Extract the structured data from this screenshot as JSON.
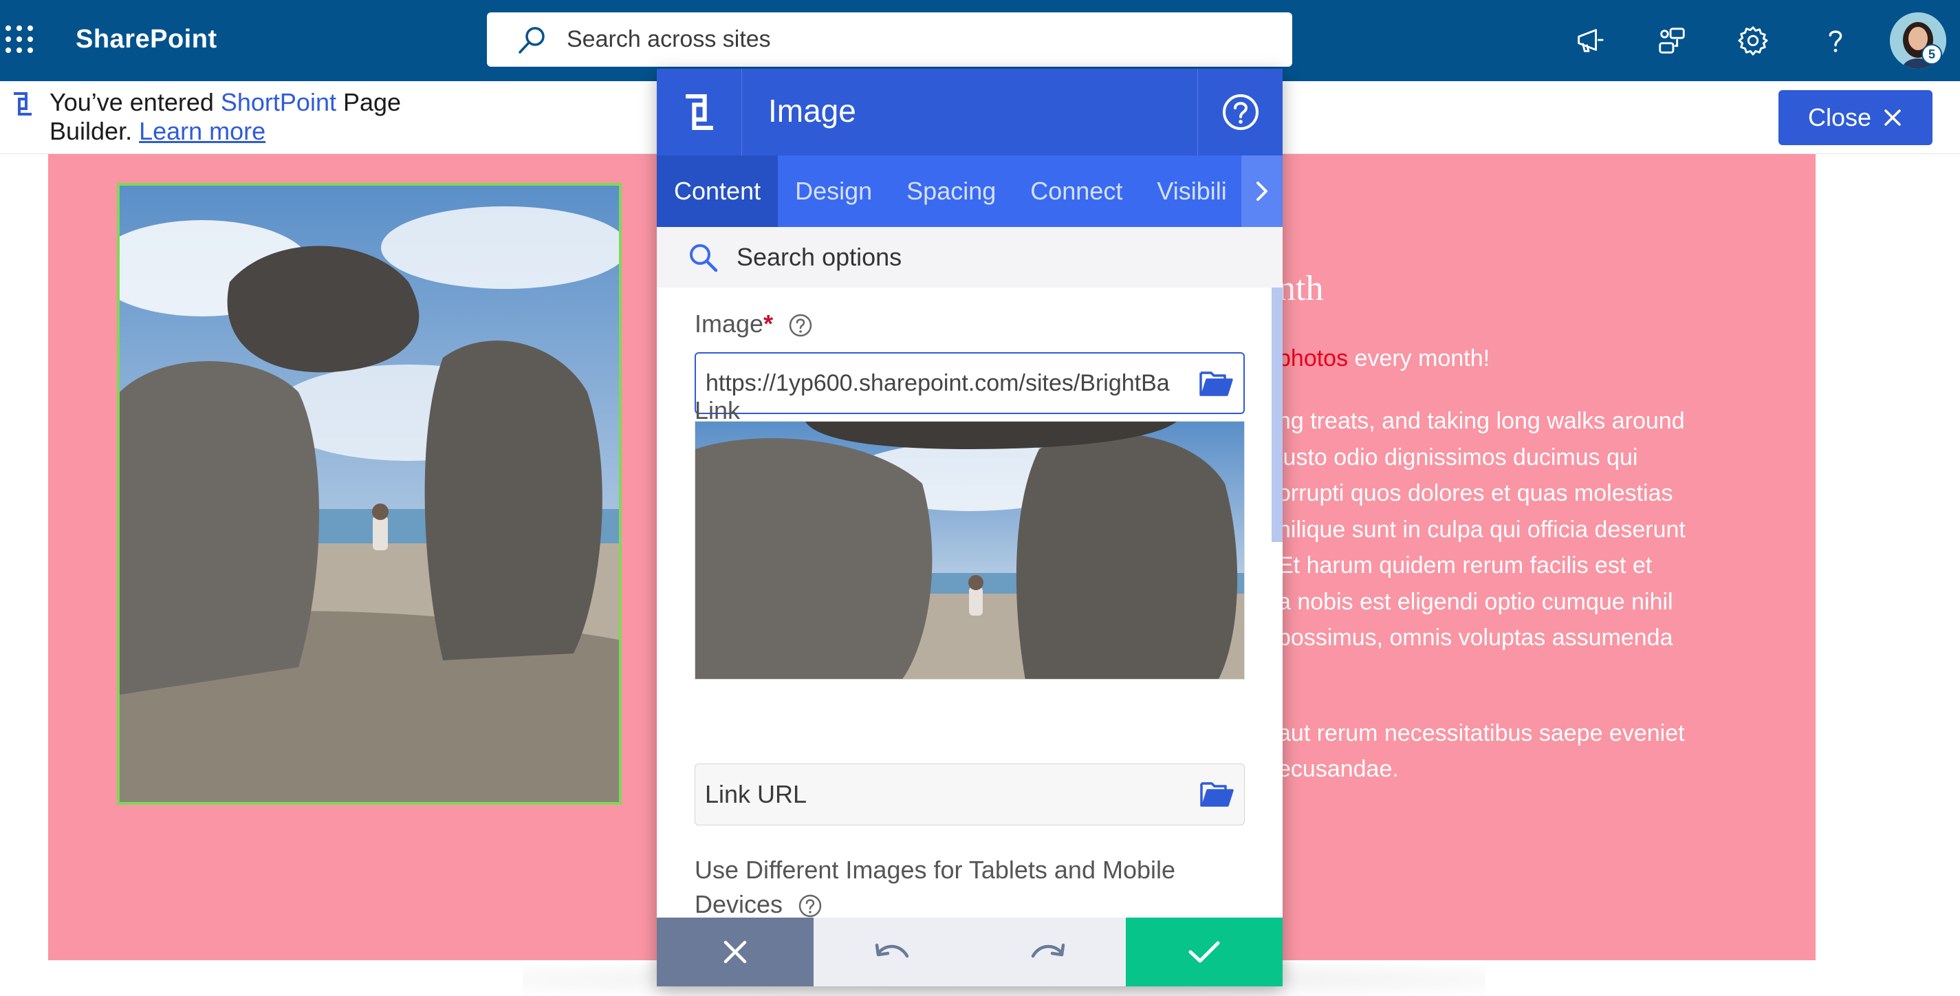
{
  "suite_bar": {
    "app_name": "SharePoint",
    "search_placeholder": "Search across sites",
    "icons": [
      "waffle-icon",
      "megaphone-icon",
      "connections-icon",
      "gear-icon",
      "help-icon"
    ],
    "avatar_badge": "5",
    "color": "#03528c"
  },
  "notice": {
    "text_before": "You’ve entered ",
    "brand": "ShortPoint",
    "text_after": " Page Builder. ",
    "learn_more": "Learn more",
    "close_label": "Close"
  },
  "page": {
    "heading_fragment": "nth",
    "sub_link": "photos",
    "sub_rest": " every month!",
    "para_lines": [
      "ng treats, and taking long walks around",
      "iusto odio dignissimos ducimus qui",
      "orrupti quos dolores et quas molestias",
      "nilique sunt in culpa qui officia deserunt",
      "Et harum quidem rerum facilis est et",
      "a nobis est eligendi optio cumque nihil",
      "possimus, omnis voluptas assumenda"
    ],
    "para2_lines": [
      "aut rerum necessitatibus saepe eveniet",
      "ecusandae."
    ],
    "section_color": "#f995a4"
  },
  "dialog": {
    "title": "Image",
    "tabs": [
      "Content",
      "Design",
      "Spacing",
      "Connect",
      "Visibili"
    ],
    "active_tab": "Content",
    "search_placeholder": "Search options",
    "image_label": "Image",
    "required_mark": "*",
    "image_url": "https://1yp600.sharepoint.com/sites/BrightBa",
    "link_label": "Link",
    "link_placeholder": "Link URL",
    "responsive_label": "Use Different Images for Tablets and Mobile Devices",
    "accent": "#2f5bd7",
    "confirm_color": "#06c48a"
  }
}
